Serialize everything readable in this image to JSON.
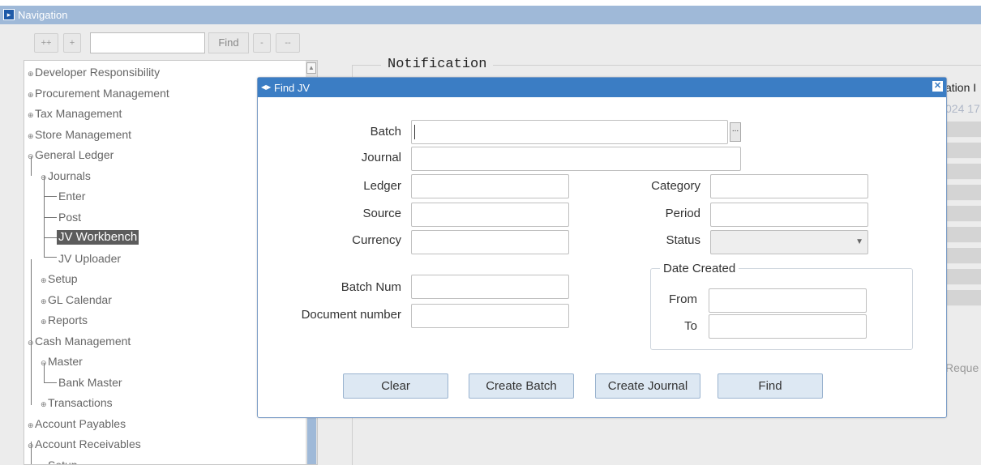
{
  "navigation": {
    "title": "Navigation",
    "toolbar": {
      "expand_all_label": "++",
      "expand_label": "+",
      "search_value": "",
      "find_label": "Find",
      "collapse_label": "-",
      "collapse_all_label": "--"
    },
    "tree": [
      {
        "label": "Developer Responsibility",
        "level": 0,
        "expanded": false
      },
      {
        "label": "Procurement Management",
        "level": 0,
        "expanded": false
      },
      {
        "label": "Tax Management",
        "level": 0,
        "expanded": false
      },
      {
        "label": "Store Management",
        "level": 0,
        "expanded": false
      },
      {
        "label": "General Ledger",
        "level": 0,
        "expanded": true
      },
      {
        "label": "Journals",
        "level": 1,
        "expanded": true
      },
      {
        "label": "Enter",
        "level": 2
      },
      {
        "label": "Post",
        "level": 2
      },
      {
        "label": "JV Workbench",
        "level": 2,
        "selected": true
      },
      {
        "label": "JV Uploader",
        "level": 2
      },
      {
        "label": "Setup",
        "level": 1,
        "expanded": false
      },
      {
        "label": "GL Calendar",
        "level": 1,
        "expanded": false
      },
      {
        "label": "Reports",
        "level": 1,
        "expanded": false
      },
      {
        "label": "Cash Management",
        "level": 0,
        "expanded": true
      },
      {
        "label": "Master",
        "level": 1,
        "expanded": true
      },
      {
        "label": "Bank Master",
        "level": 2
      },
      {
        "label": "Transactions",
        "level": 1,
        "expanded": false
      },
      {
        "label": "Account Payables",
        "level": 0,
        "expanded": false
      },
      {
        "label": "Account Receivables",
        "level": 0,
        "expanded": true
      },
      {
        "label": "Setup",
        "level": 1,
        "expanded": true
      }
    ]
  },
  "notification": {
    "title": "Notification",
    "column_partial": "ation I",
    "date_partial": "024 17",
    "request_partial": "Reque"
  },
  "dialog": {
    "title": "Find JV",
    "close_label": "x",
    "fields": {
      "batch": {
        "label": "Batch",
        "value": ""
      },
      "journal": {
        "label": "Journal",
        "value": ""
      },
      "ledger": {
        "label": "Ledger",
        "value": ""
      },
      "source": {
        "label": "Source",
        "value": ""
      },
      "currency": {
        "label": "Currency",
        "value": ""
      },
      "category": {
        "label": "Category",
        "value": ""
      },
      "period": {
        "label": "Period",
        "value": ""
      },
      "status": {
        "label": "Status",
        "value": ""
      },
      "batch_num": {
        "label": "Batch Num",
        "value": ""
      },
      "document_number": {
        "label": "Document number",
        "value": ""
      }
    },
    "lov_label": "...",
    "date_created": {
      "title": "Date Created",
      "from_label": "From",
      "from_value": "",
      "to_label": "To",
      "to_value": ""
    },
    "buttons": {
      "clear": "Clear",
      "create_batch": "Create Batch",
      "create_journal": "Create Journal",
      "find": "Find"
    }
  }
}
